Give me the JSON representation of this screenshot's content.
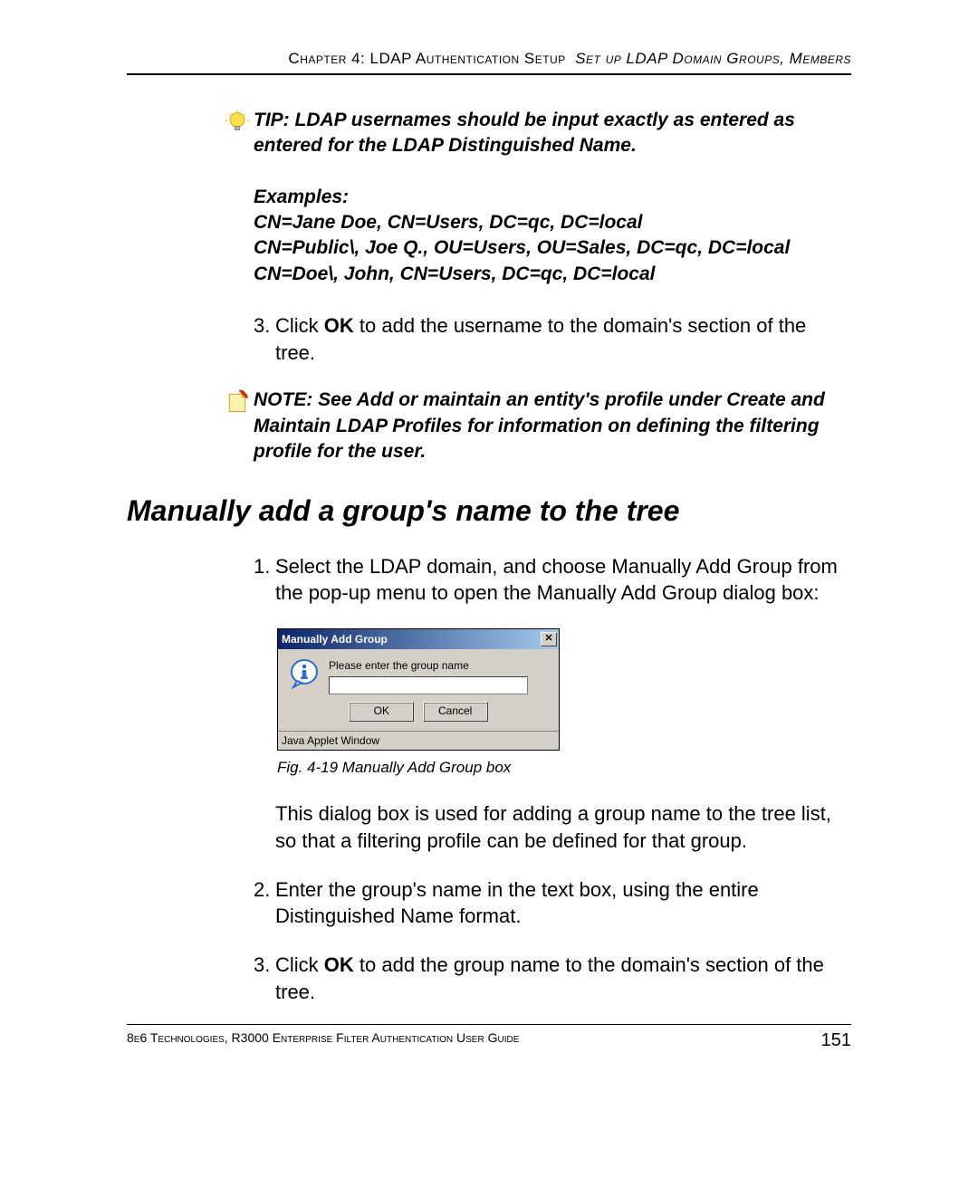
{
  "header": {
    "chapter": "Chapter 4: LDAP Authentication Setup",
    "section": "Set up LDAP Domain Groups, Members"
  },
  "tip": {
    "label": "TIP",
    "text": ": LDAP usernames should be input exactly as entered as entered for the LDAP Distinguished Name."
  },
  "examples": {
    "label": "Examples:",
    "lines": [
      "CN=Jane Doe, CN=Users, DC=qc, DC=local",
      "CN=Public\\, Joe Q., OU=Users, OU=Sales, DC=qc, DC=local",
      "CN=Doe\\, John, CN=Users, DC=qc, DC=local"
    ]
  },
  "step_pre_3": {
    "num": "3.",
    "before": "Click ",
    "bold": "OK",
    "after": " to add the username to the domain's section of the tree."
  },
  "note": {
    "label": "NOTE",
    "text": ": See Add or maintain an entity's profile under Create and Maintain LDAP Profiles for information on defining the filtering profile for the user."
  },
  "section_heading": "Manually add a group's name to the tree",
  "step1": {
    "num": "1.",
    "text": "Select the LDAP domain, and choose Manually Add Group from the pop-up menu to open the Manually Add Group dialog box:"
  },
  "dialog": {
    "title": "Manually Add Group",
    "close_glyph": "✕",
    "prompt": "Please enter the group name",
    "ok": "OK",
    "cancel": "Cancel",
    "applet_bar": "Java Applet Window"
  },
  "fig_caption": "Fig. 4-19  Manually Add Group box",
  "para_after_fig": "This dialog box is used for adding a group name to the tree list, so that a filtering profile can be defined for that group.",
  "step2": {
    "num": "2.",
    "text": "Enter the group's name in the text box, using the entire Distinguished Name format."
  },
  "step3": {
    "num": "3.",
    "before": "Click ",
    "bold": "OK",
    "after": " to add the group name to the domain's section of the tree."
  },
  "footer": {
    "left": "8e6 Technologies, R3000 Enterprise Filter Authentication User Guide",
    "page": "151"
  }
}
